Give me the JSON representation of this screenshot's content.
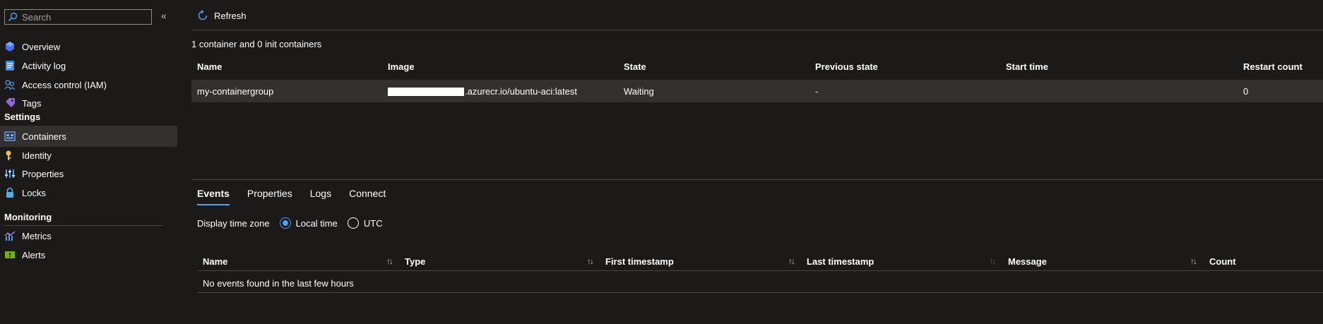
{
  "sidebar": {
    "search_placeholder": "Search",
    "collapse_glyph": "«",
    "items": [
      {
        "label": "Overview",
        "icon": "overview-icon"
      },
      {
        "label": "Activity log",
        "icon": "activity-log-icon"
      },
      {
        "label": "Access control (IAM)",
        "icon": "iam-icon"
      },
      {
        "label": "Tags",
        "icon": "tag-icon"
      }
    ],
    "settings_header": "Settings",
    "settings_items": [
      {
        "label": "Containers",
        "icon": "containers-icon",
        "active": true
      },
      {
        "label": "Identity",
        "icon": "identity-icon"
      },
      {
        "label": "Properties",
        "icon": "properties-icon"
      },
      {
        "label": "Locks",
        "icon": "lock-icon"
      }
    ],
    "monitoring_header": "Monitoring",
    "monitoring_items": [
      {
        "label": "Metrics",
        "icon": "metrics-icon"
      },
      {
        "label": "Alerts",
        "icon": "alerts-icon"
      }
    ]
  },
  "toolbar": {
    "refresh_label": "Refresh"
  },
  "summary": "1 container and 0 init containers",
  "containers_table": {
    "columns": [
      "Name",
      "Image",
      "State",
      "Previous state",
      "Start time",
      "Restart count"
    ],
    "rows": [
      {
        "name": "my-containergroup",
        "image_suffix": ".azurecr.io/ubuntu-aci:latest",
        "state": "Waiting",
        "previous_state": "-",
        "start_time": "",
        "restart_count": "0"
      }
    ]
  },
  "tabs": [
    "Events",
    "Properties",
    "Logs",
    "Connect"
  ],
  "timezone": {
    "label": "Display time zone",
    "options": [
      "Local time",
      "UTC"
    ],
    "selected": "Local time"
  },
  "events_table": {
    "columns": [
      "Name",
      "Type",
      "First timestamp",
      "Last timestamp",
      "Message",
      "Count"
    ],
    "empty_text": "No events found in the last few hours"
  },
  "colors": {
    "accent": "#4f9ff0",
    "background": "#1b1a19",
    "selected_row": "#323130"
  }
}
